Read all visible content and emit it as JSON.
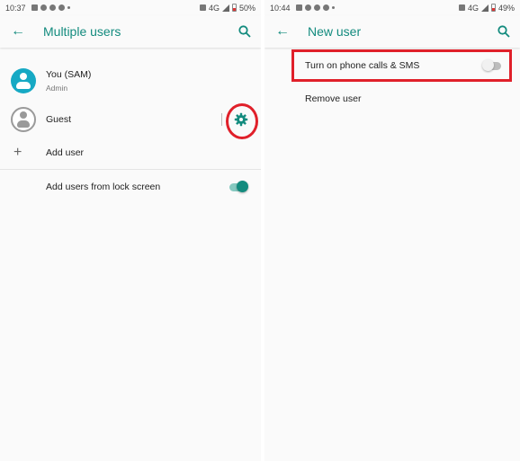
{
  "left": {
    "status": {
      "time": "10:37",
      "network": "4G",
      "battery": "50%"
    },
    "appbar": {
      "title": "Multiple users",
      "back_icon": "arrow-back-icon",
      "search_icon": "search-icon"
    },
    "users": [
      {
        "name": "You (SAM)",
        "role": "Admin",
        "avatar": "person-avatar-teal"
      },
      {
        "name": "Guest",
        "avatar": "person-avatar-grey",
        "settings_icon": "gear-icon"
      }
    ],
    "add_user_label": "Add user",
    "lock_screen": {
      "label": "Add users from lock screen",
      "enabled": true
    }
  },
  "right": {
    "status": {
      "time": "10:44",
      "network": "4G",
      "battery": "49%"
    },
    "appbar": {
      "title": "New user",
      "back_icon": "arrow-back-icon",
      "search_icon": "search-icon"
    },
    "phone_calls": {
      "label": "Turn on phone calls & SMS",
      "enabled": false
    },
    "remove_user_label": "Remove user"
  },
  "colors": {
    "accent": "#138b7e",
    "annotation": "#e0202a",
    "avatar_teal": "#16a9c4"
  }
}
